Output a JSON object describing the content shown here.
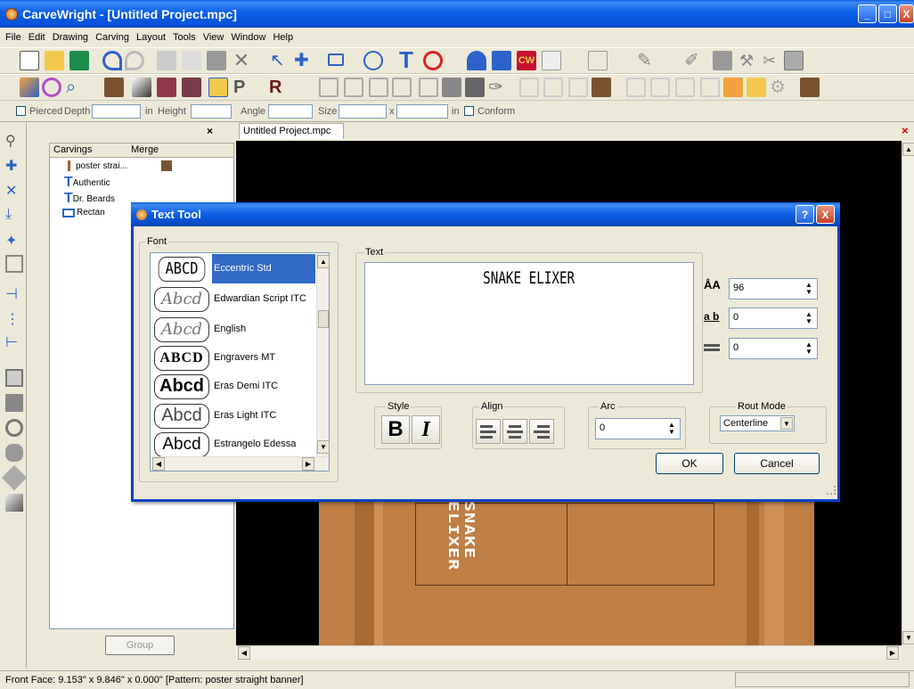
{
  "window": {
    "title": "CarveWright - [Untitled Project.mpc]",
    "minimize": "_",
    "maximize": "□",
    "close": "X"
  },
  "menu": [
    "File",
    "Edit",
    "Drawing",
    "Carving",
    "Layout",
    "Tools",
    "View",
    "Window",
    "Help"
  ],
  "options": {
    "pierced": "Pierced",
    "depth": "Depth",
    "unit1": "in",
    "height": "Height",
    "angle": "Angle",
    "size": "Size",
    "x": "x",
    "unit2": "in",
    "conform": "Conform"
  },
  "tree": {
    "headers": [
      "Carvings",
      "Merge"
    ],
    "rows": [
      "poster strai...",
      "Authentic",
      "Dr. Beards",
      "Rectan"
    ],
    "group_button": "Group"
  },
  "document": {
    "tab": "Untitled Project.mpc",
    "close": "×",
    "canvas_text": "SNAKE ELIXER"
  },
  "dialog": {
    "title": "Text Tool",
    "help": "?",
    "close": "X",
    "font_group": "Font",
    "fonts": [
      {
        "preview": "ABCD",
        "name": "Eccentric Std"
      },
      {
        "preview": "Abcd",
        "name": "Edwardian Script ITC"
      },
      {
        "preview": "Abcd",
        "name": "English"
      },
      {
        "preview": "ABCD",
        "name": "Engravers MT"
      },
      {
        "preview": "Abcd",
        "name": "Eras Demi ITC"
      },
      {
        "preview": "Abcd",
        "name": "Eras Light ITC"
      },
      {
        "preview": "Abcd",
        "name": "Estrangelo Edessa"
      }
    ],
    "text_group": "Text",
    "text_value": "SNAKE ELIXER",
    "font_size": "96",
    "char_spacing": "0",
    "line_spacing": "0",
    "style_group": "Style",
    "bold": "B",
    "italic": "I",
    "align_group": "Align",
    "arc_group": "Arc",
    "arc_value": "0",
    "rout_group": "Rout Mode",
    "rout_value": "Centerline",
    "ok": "OK",
    "cancel": "Cancel"
  },
  "status": {
    "text": "Front Face: 9.153\" x 9.846\" x 0.000\"  [Pattern: poster straight banner]"
  },
  "colors": {
    "xp_blue": "#0b5ee6",
    "selection": "#316ac5",
    "wood": "#bf7f45"
  }
}
